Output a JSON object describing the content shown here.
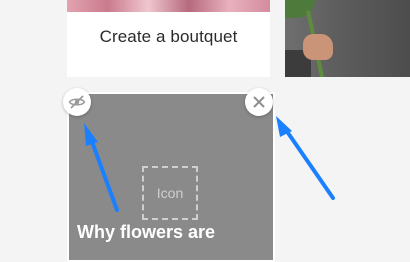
{
  "cards": {
    "top": {
      "title": "Create a boutquet"
    },
    "bottom": {
      "placeholder_label": "Icon",
      "heading": "Why flowers are"
    }
  },
  "controls": {
    "hide_icon": "eye-off-icon",
    "close_icon": "close-icon"
  },
  "colors": {
    "page_bg": "#f4f4f4",
    "card_overlay": "#8a8a8a",
    "arrow": "#1a80ff"
  }
}
